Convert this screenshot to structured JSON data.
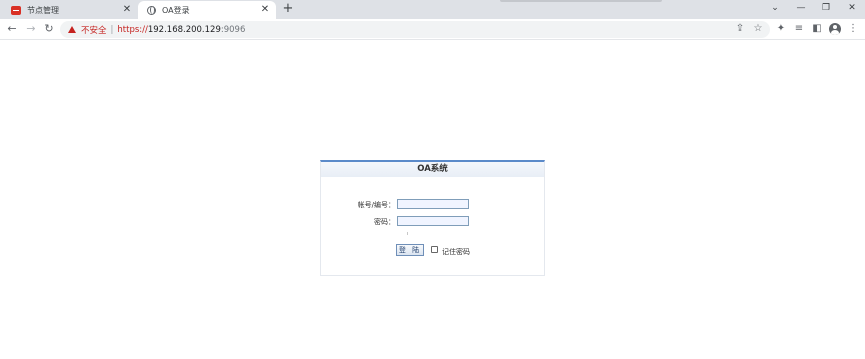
{
  "browser": {
    "tabs": [
      {
        "title": "节点管理",
        "icon": "red-app-favicon-icon"
      },
      {
        "title": "OA登录",
        "icon": "globe-icon"
      }
    ],
    "newtab_glyph": "+",
    "address": {
      "security_text": "不安全",
      "separator": "|",
      "scheme": "https://",
      "host": "192.168.200.129",
      "port": ":9096"
    }
  },
  "login": {
    "title": "OA系统",
    "account_label": "帐号/编号：",
    "password_label": "密码：",
    "account_value": "",
    "password_value": "",
    "submit_label": "登 陆",
    "remember_label": "记住密码",
    "remember_checked": false
  },
  "colors": {
    "accent": "#5b8ac9",
    "warning": "#c5221f"
  }
}
